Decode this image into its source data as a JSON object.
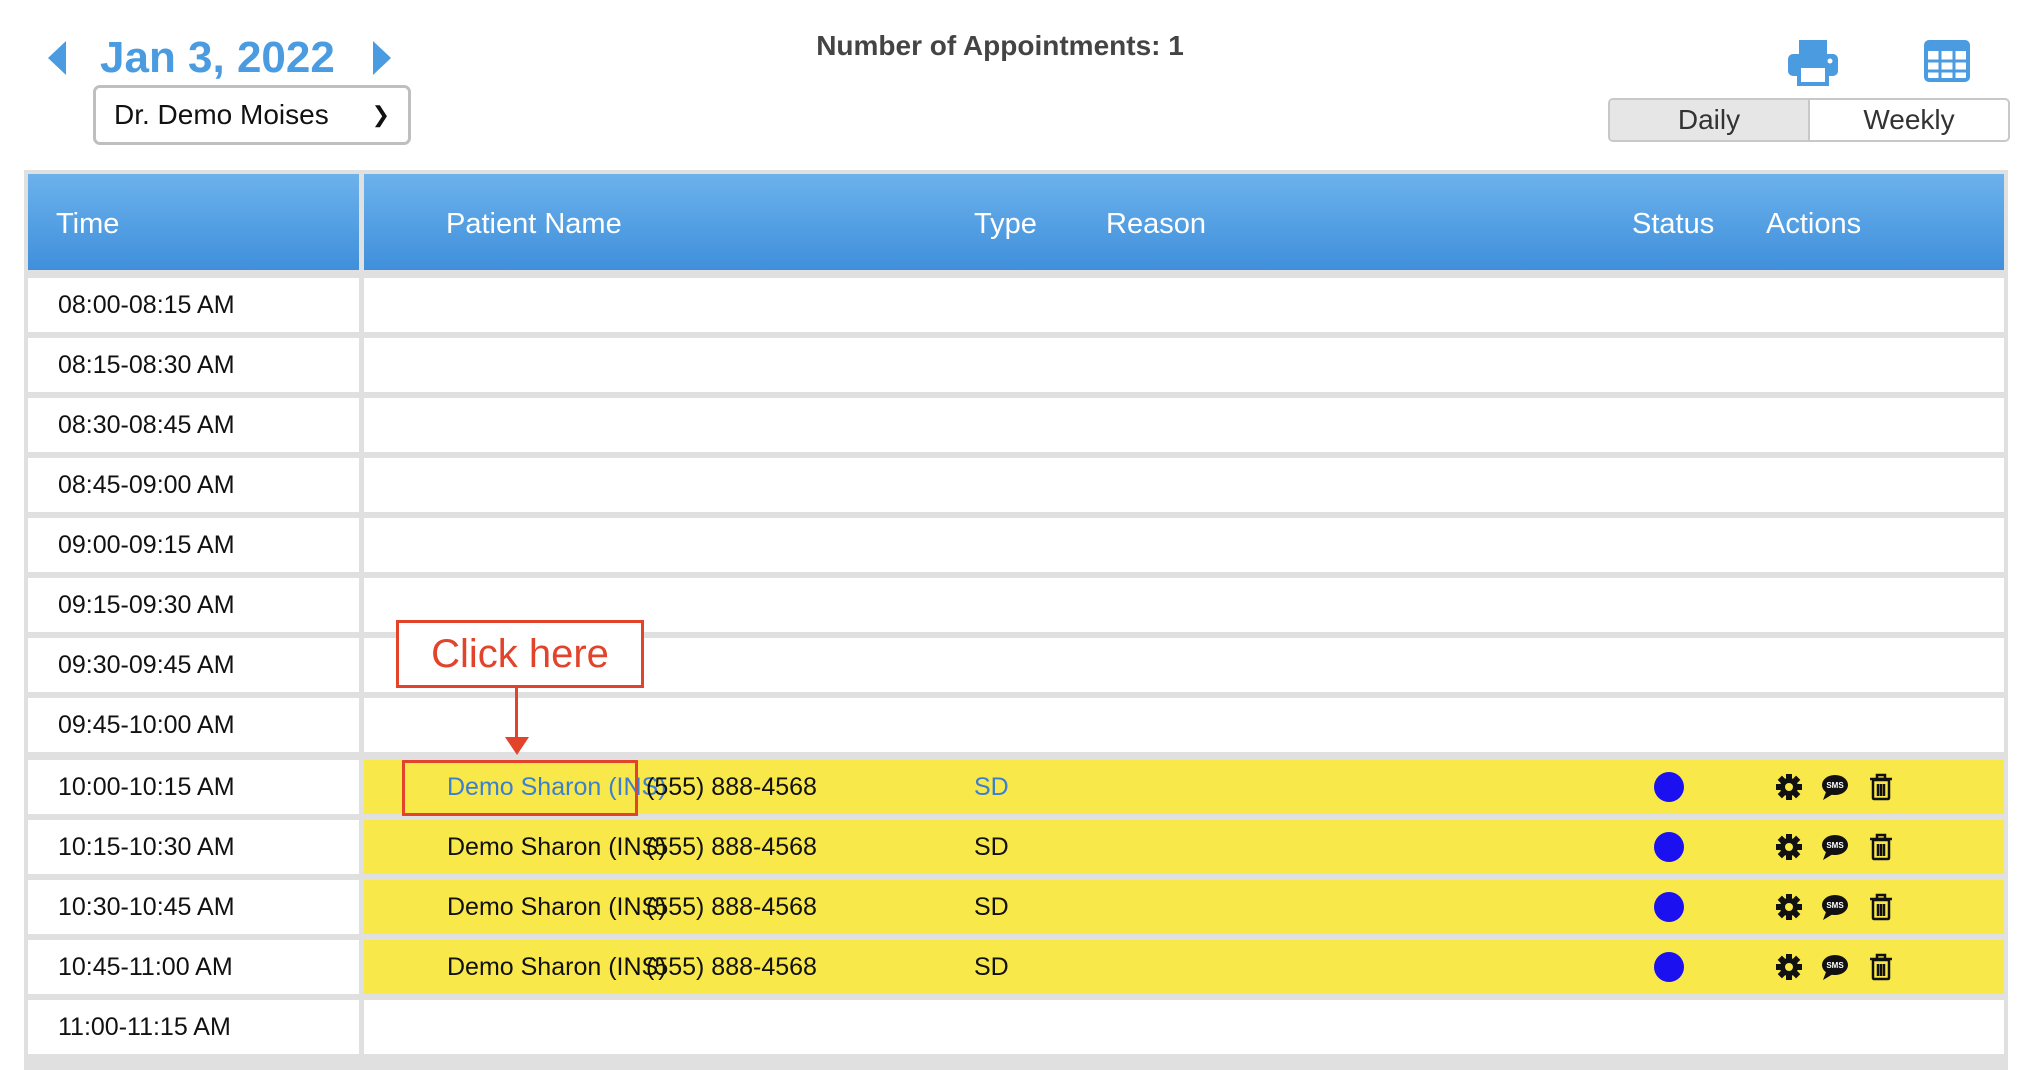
{
  "header": {
    "date": "Jan 3, 2022",
    "doctor_selected": "Dr. Demo Moises",
    "appointment_count": "Number of Appointments: 1",
    "views": {
      "daily": "Daily",
      "weekly": "Weekly"
    }
  },
  "columns": {
    "time": "Time",
    "patient": "Patient Name",
    "type": "Type",
    "reason": "Reason",
    "status": "Status",
    "actions": "Actions"
  },
  "slots": [
    {
      "time": "08:00-08:15 AM"
    },
    {
      "time": "08:15-08:30 AM"
    },
    {
      "time": "08:30-08:45 AM"
    },
    {
      "time": "08:45-09:00 AM"
    },
    {
      "time": "09:00-09:15 AM"
    },
    {
      "time": "09:15-09:30 AM"
    },
    {
      "time": "09:30-09:45 AM"
    },
    {
      "time": "09:45-10:00 AM"
    },
    {
      "time": "10:00-10:15 AM",
      "patient": "Demo Sharon (INS)",
      "phone": "(555) 888-4568",
      "type": "SD"
    },
    {
      "time": "10:15-10:30 AM",
      "patient": "Demo Sharon (INS)",
      "phone": "(555) 888-4568",
      "type": "SD"
    },
    {
      "time": "10:30-10:45 AM",
      "patient": "Demo Sharon (INS)",
      "phone": "(555) 888-4568",
      "type": "SD"
    },
    {
      "time": "10:45-11:00 AM",
      "patient": "Demo Sharon (INS)",
      "phone": "(555) 888-4568",
      "type": "SD"
    },
    {
      "time": "11:00-11:15 AM"
    }
  ],
  "annotation": {
    "text": "Click here"
  },
  "colors": {
    "accent": "#4a9be0",
    "booked": "#f9e84a",
    "status": "#1a10f0",
    "annotation": "#e2432b"
  }
}
